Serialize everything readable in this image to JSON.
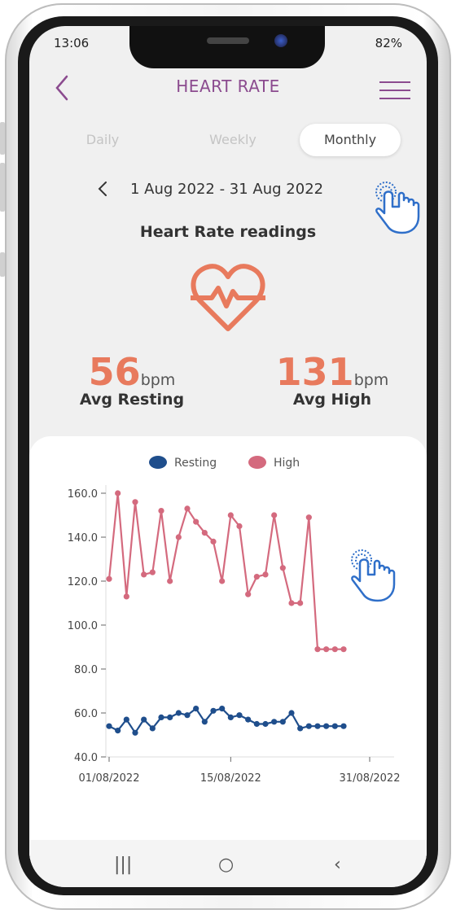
{
  "status": {
    "time": "13:06",
    "battery": "82%"
  },
  "header": {
    "title": "HEART RATE"
  },
  "tabs": [
    {
      "label": "Daily",
      "active": false
    },
    {
      "label": "Weekly",
      "active": false
    },
    {
      "label": "Monthly",
      "active": true
    }
  ],
  "date_range": {
    "text": "1 Aug 2022 - 31 Aug 2022"
  },
  "readings": {
    "title": "Heart Rate readings"
  },
  "stats": {
    "resting": {
      "value": "56",
      "unit": "bpm",
      "label": "Avg Resting"
    },
    "high": {
      "value": "131",
      "unit": "bpm",
      "label": "Avg High"
    }
  },
  "colors": {
    "accent": "#8b4b8f",
    "heart": "#e87a5d",
    "resting": "#1f4e8c",
    "high": "#d46a7e"
  },
  "chart_data": {
    "type": "line",
    "legend": [
      "Resting",
      "High"
    ],
    "x_ticks": [
      "01/08/2022",
      "15/08/2022",
      "31/08/2022"
    ],
    "y_ticks": [
      "40.0",
      "60.0",
      "80.0",
      "100.0",
      "120.0",
      "140.0",
      "160.0"
    ],
    "ylim": [
      40,
      160
    ],
    "xlim_days": [
      1,
      31
    ],
    "series": [
      {
        "name": "Resting",
        "color": "#1f4e8c",
        "x": [
          1,
          2,
          3,
          4,
          5,
          6,
          7,
          8,
          9,
          10,
          11,
          12,
          13,
          14,
          15,
          16,
          17,
          18,
          19,
          20,
          21,
          22,
          23,
          24,
          25,
          26,
          27,
          28
        ],
        "values": [
          54,
          52,
          57,
          51,
          57,
          53,
          58,
          58,
          60,
          59,
          62,
          56,
          61,
          62,
          58,
          59,
          57,
          55,
          55,
          56,
          56,
          60,
          53,
          54,
          54,
          54,
          54,
          54
        ]
      },
      {
        "name": "High",
        "color": "#d46a7e",
        "x": [
          1,
          2,
          3,
          4,
          5,
          6,
          7,
          8,
          9,
          10,
          11,
          12,
          13,
          14,
          15,
          16,
          17,
          18,
          19,
          20,
          21,
          22,
          23,
          24,
          25,
          26,
          27,
          28
        ],
        "values": [
          121,
          160,
          113,
          156,
          123,
          124,
          152,
          120,
          140,
          153,
          147,
          142,
          138,
          120,
          150,
          145,
          114,
          122,
          123,
          150,
          126,
          110,
          110,
          149,
          89,
          89,
          89,
          89
        ]
      }
    ]
  },
  "navbar": {
    "recent": "|||",
    "home": "○",
    "back": "‹"
  }
}
